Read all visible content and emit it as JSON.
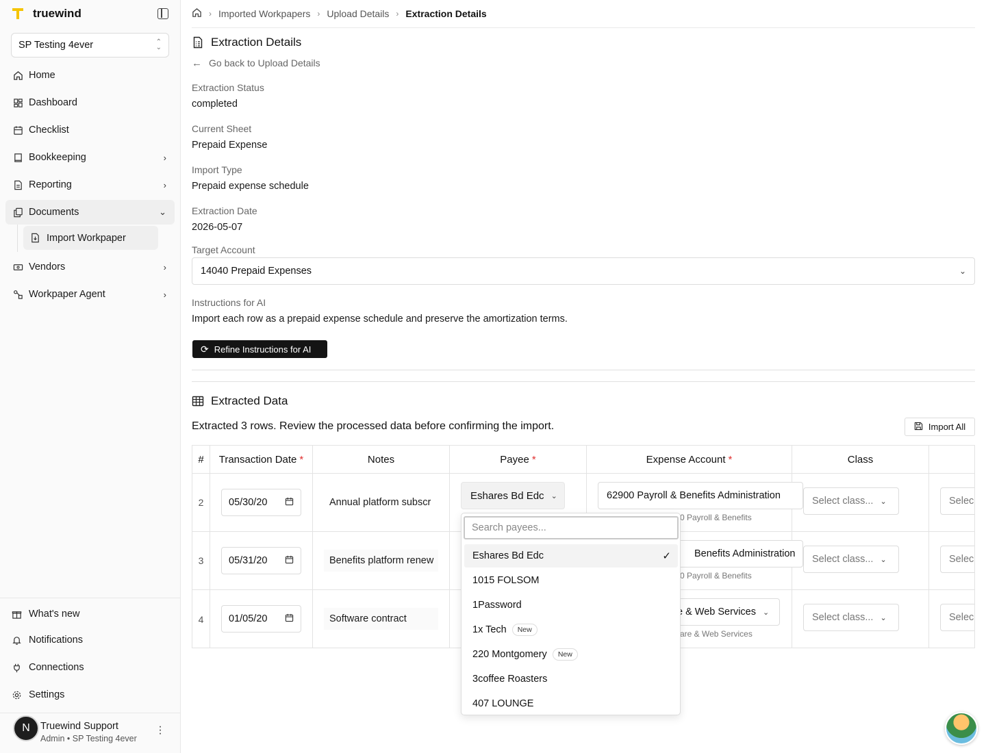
{
  "app": {
    "brand": "truewind",
    "org": "SP Testing 4ever"
  },
  "sidebar": {
    "items": [
      {
        "label": "Home",
        "icon": "home-icon"
      },
      {
        "label": "Dashboard",
        "icon": "dashboard-icon"
      },
      {
        "label": "Checklist",
        "icon": "calendar-icon"
      },
      {
        "label": "Bookkeeping",
        "icon": "book-icon"
      },
      {
        "label": "Reporting",
        "icon": "report-icon"
      },
      {
        "label": "Documents",
        "icon": "documents-icon"
      },
      {
        "label": "Vendors",
        "icon": "vendors-icon"
      },
      {
        "label": "Workpaper Agent",
        "icon": "agent-icon"
      }
    ],
    "sub_item": "Import Workpaper",
    "footer": [
      {
        "label": "What's new",
        "icon": "gift-icon"
      },
      {
        "label": "Notifications",
        "icon": "bell-icon"
      },
      {
        "label": "Connections",
        "icon": "plug-icon"
      },
      {
        "label": "Settings",
        "icon": "gear-icon"
      }
    ],
    "user": {
      "initial": "N",
      "name": "Truewind Support",
      "role": "Admin • SP Testing 4ever"
    }
  },
  "breadcrumb": {
    "items": [
      "Imported Workpapers",
      "Upload Details"
    ],
    "current": "Extraction Details"
  },
  "page": {
    "title": "Extraction Details",
    "back_link": "Go back to Upload Details",
    "fields": [
      {
        "label": "Extraction Status",
        "value": "completed"
      },
      {
        "label": "Current Sheet",
        "value": "Prepaid Expense"
      },
      {
        "label": "Import Type",
        "value": "Prepaid expense schedule"
      },
      {
        "label": "Extraction Date",
        "value": "2026-05-07"
      }
    ],
    "target_account_label": "Target Account",
    "target_account_value": "14040 Prepaid Expenses",
    "instructions_label": "Instructions for AI",
    "instructions_value": "Import each row as a prepaid expense schedule and preserve the amortization terms.",
    "refine_button": "Refine Instructions for AI"
  },
  "extracted": {
    "title": "Extracted Data",
    "summary": "Extracted 3 rows. Review the processed data before confirming the import.",
    "import_all": "Import All",
    "columns": {
      "num": "#",
      "date": "Transaction Date",
      "notes": "Notes",
      "payee": "Payee",
      "account": "Expense Account",
      "class": "Class",
      "required_mark": "*"
    },
    "rows": [
      {
        "num": "2",
        "date": "05/30/20",
        "notes": "Annual platform subscr",
        "payee": "Eshares Bd Edc",
        "account": "62900 Payroll & Benefits Administration",
        "account_sub": "0 Payroll & Benefits",
        "class": "Select class...",
        "extra": "Selec"
      },
      {
        "num": "3",
        "date": "05/31/20",
        "notes": "Benefits platform renew",
        "account": "Benefits Administration",
        "account_sub": "0 Payroll & Benefits",
        "class": "Select class...",
        "extra": "Selec"
      },
      {
        "num": "4",
        "date": "01/05/20",
        "notes": "Software contract",
        "account": "e & Web Services",
        "account_sub": "are & Web Services",
        "class": "Select class...",
        "extra": "Selec"
      }
    ]
  },
  "payee_dropdown": {
    "search_placeholder": "Search payees...",
    "options": [
      {
        "label": "Eshares Bd Edc",
        "selected": true,
        "badge": ""
      },
      {
        "label": "1015 FOLSOM",
        "selected": false,
        "badge": ""
      },
      {
        "label": "1Password",
        "selected": false,
        "badge": ""
      },
      {
        "label": "1x Tech",
        "selected": false,
        "badge": "New"
      },
      {
        "label": "220 Montgomery",
        "selected": false,
        "badge": "New"
      },
      {
        "label": "3coffee Roasters",
        "selected": false,
        "badge": ""
      },
      {
        "label": "407 LOUNGE",
        "selected": false,
        "badge": ""
      }
    ]
  },
  "colors": {
    "accent_logo": "#f5c400",
    "primary_button": "#141414",
    "required": "#e03131"
  }
}
